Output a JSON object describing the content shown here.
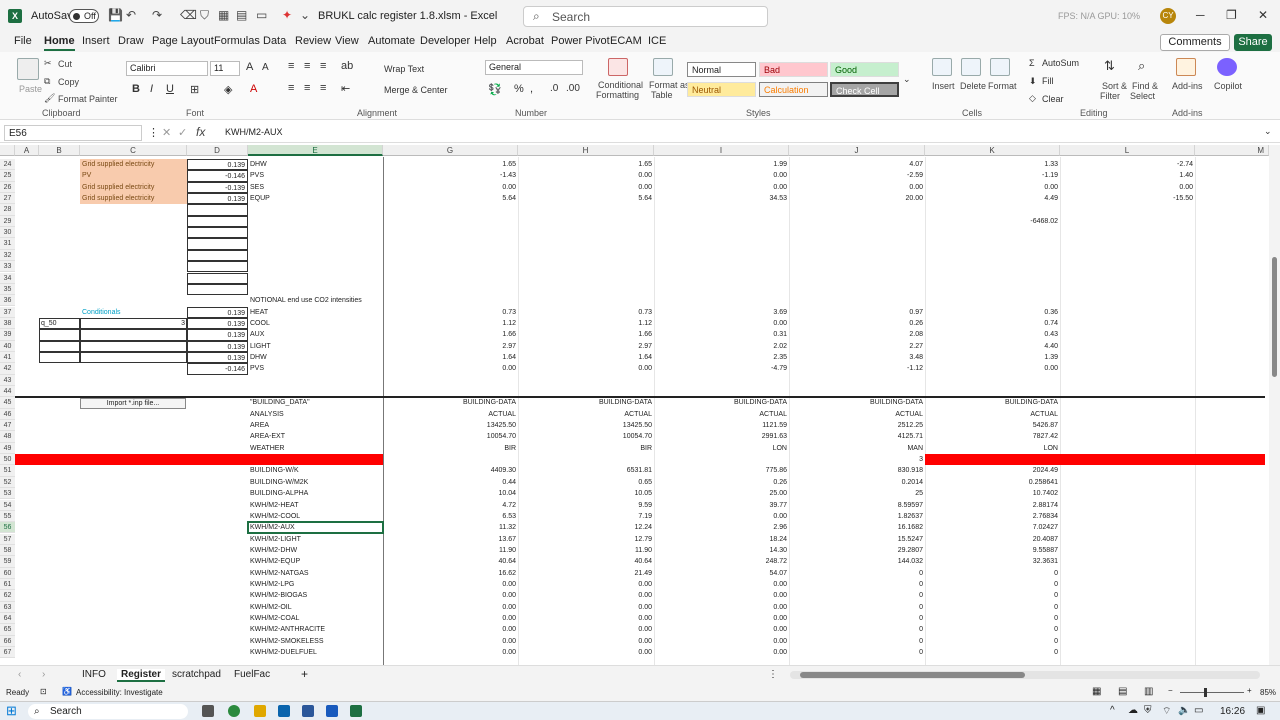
{
  "app": {
    "autosave_label": "AutoSave",
    "toggle_label": "Off",
    "title": "BRUKL calc register 1.8.xlsm  -  Excel",
    "search_placeholder": "Search",
    "status_top": "FPS: N/A    GPU: 10%",
    "avatar": "CY"
  },
  "tabs": [
    "File",
    "Home",
    "Insert",
    "Draw",
    "Page Layout",
    "Formulas",
    "Data",
    "Review",
    "View",
    "Automate",
    "Developer",
    "Help",
    "Acrobat",
    "Power Pivot",
    "ECAM",
    "ICE"
  ],
  "comments": "Comments",
  "share": "Share",
  "ribbon": {
    "clipboard": {
      "paste": "Paste",
      "cut": "Cut",
      "copy": "Copy",
      "painter": "Format Painter",
      "group": "Clipboard"
    },
    "font": {
      "name": "Calibri",
      "size": "11",
      "group": "Font"
    },
    "alignment": {
      "wrap": "Wrap Text",
      "merge": "Merge & Center",
      "group": "Alignment"
    },
    "number": {
      "format": "General",
      "group": "Number"
    },
    "styles": {
      "cond": "Conditional",
      "cond2": "Formatting",
      "table": "Format as",
      "table2": "Table",
      "normal": "Normal",
      "bad": "Bad",
      "good": "Good",
      "neutral": "Neutral",
      "calculation": "Calculation",
      "check": "Check Cell",
      "group": "Styles"
    },
    "cells": {
      "insert": "Insert",
      "delete": "Delete",
      "format": "Format",
      "group": "Cells"
    },
    "editing": {
      "autosum": "AutoSum",
      "fill": "Fill",
      "clear": "Clear",
      "sort": "Sort &",
      "sort2": "Filter",
      "find": "Find &",
      "find2": "Select",
      "group": "Editing"
    },
    "addins": {
      "label": "Add-ins",
      "group": "Add-ins"
    },
    "copilot": {
      "label": "Copilot"
    }
  },
  "formula_bar": {
    "name_box": "E56",
    "formula": "KWH/M2-AUX"
  },
  "columns": [
    "A",
    "B",
    "C",
    "D",
    "E",
    "G",
    "H",
    "I",
    "J",
    "K",
    "L",
    "M"
  ],
  "rows": [
    {
      "n": "24",
      "c": "Grid supplied electricity",
      "d": "0.139",
      "e": "DHW",
      "g": "1.65",
      "h": "1.65",
      "i": "1.99",
      "j": "4.07",
      "k": "1.33",
      "l": "-2.74"
    },
    {
      "n": "25",
      "c": "PV",
      "d": "-0.146",
      "e": "PVS",
      "g": "-1.43",
      "h": "0.00",
      "i": "0.00",
      "j": "-2.59",
      "k": "-1.19",
      "l": "1.40"
    },
    {
      "n": "26",
      "c": "Grid supplied electricity",
      "d": "-0.139",
      "e": "SES",
      "g": "0.00",
      "h": "0.00",
      "i": "0.00",
      "j": "0.00",
      "k": "0.00",
      "l": "0.00"
    },
    {
      "n": "27",
      "c": "Grid supplied electricity",
      "d": "0.139",
      "e": "EQUP",
      "g": "5.64",
      "h": "5.64",
      "i": "34.53",
      "j": "20.00",
      "k": "4.49",
      "l": "-15.50"
    },
    {
      "n": "28"
    },
    {
      "n": "29",
      "k": "-6468.02"
    },
    {
      "n": "30"
    },
    {
      "n": "31"
    },
    {
      "n": "32"
    },
    {
      "n": "33"
    },
    {
      "n": "34"
    },
    {
      "n": "35"
    },
    {
      "n": "36",
      "e": "NOTIONAL end use CO2 intensities"
    },
    {
      "n": "37",
      "c": "Conditionals",
      "d": "0.139",
      "e": "HEAT",
      "g": "0.73",
      "h": "0.73",
      "i": "3.69",
      "j": "0.97",
      "k": "0.36"
    },
    {
      "n": "38",
      "b": "q_50",
      "c": "3",
      "d": "0.139",
      "e": "COOL",
      "g": "1.12",
      "h": "1.12",
      "i": "0.00",
      "j": "0.26",
      "k": "0.74"
    },
    {
      "n": "39",
      "d": "0.139",
      "e": "AUX",
      "g": "1.66",
      "h": "1.66",
      "i": "0.31",
      "j": "2.08",
      "k": "0.43"
    },
    {
      "n": "40",
      "d": "0.139",
      "e": "LIGHT",
      "g": "2.97",
      "h": "2.97",
      "i": "2.02",
      "j": "2.27",
      "k": "4.40"
    },
    {
      "n": "41",
      "d": "0.139",
      "e": "DHW",
      "g": "1.64",
      "h": "1.64",
      "i": "2.35",
      "j": "3.48",
      "k": "1.39"
    },
    {
      "n": "42",
      "d": "-0.146",
      "e": "PVS",
      "g": "0.00",
      "h": "0.00",
      "i": "-4.79",
      "j": "-1.12",
      "k": "0.00"
    },
    {
      "n": "43"
    },
    {
      "n": "44"
    },
    {
      "n": "45",
      "e": "\"BUILDING_DATA\"",
      "g": "BUILDING-DATA",
      "h": "BUILDING-DATA",
      "i": "BUILDING-DATA",
      "j": "BUILDING-DATA",
      "k": "BUILDING-DATA"
    },
    {
      "n": "46",
      "e": "ANALYSIS",
      "g": "ACTUAL",
      "h": "ACTUAL",
      "i": "ACTUAL",
      "j": "ACTUAL",
      "k": "ACTUAL"
    },
    {
      "n": "47",
      "e": "AREA",
      "g": "13425.50",
      "h": "13425.50",
      "i": "1121.59",
      "j": "2512.25",
      "k": "5426.87"
    },
    {
      "n": "48",
      "e": "AREA-EXT",
      "g": "10054.70",
      "h": "10054.70",
      "i": "2991.63",
      "j": "4125.71",
      "k": "7827.42"
    },
    {
      "n": "49",
      "e": "WEATHER",
      "g": "BIR",
      "h": "BIR",
      "i": "LON",
      "j": "MAN",
      "k": "LON"
    },
    {
      "n": "50",
      "g": "3.00",
      "h": "3.00",
      "i": "3.00",
      "j": "3"
    },
    {
      "n": "51",
      "e": "BUILDING-W/K",
      "g": "4409.30",
      "h": "6531.81",
      "i": "775.86",
      "j": "830.918",
      "k": "2024.49"
    },
    {
      "n": "52",
      "e": "BUILDING-W/M2K",
      "g": "0.44",
      "h": "0.65",
      "i": "0.26",
      "j": "0.2014",
      "k": "0.258641"
    },
    {
      "n": "53",
      "e": "BUILDING-ALPHA",
      "g": "10.04",
      "h": "10.05",
      "i": "25.00",
      "j": "25",
      "k": "10.7402"
    },
    {
      "n": "54",
      "e": "KWH/M2-HEAT",
      "g": "4.72",
      "h": "9.59",
      "i": "39.77",
      "j": "8.59597",
      "k": "2.88174"
    },
    {
      "n": "55",
      "e": "KWH/M2-COOL",
      "g": "6.53",
      "h": "7.19",
      "i": "0.00",
      "j": "1.82637",
      "k": "2.76834"
    },
    {
      "n": "56",
      "e": "KWH/M2-AUX",
      "g": "11.32",
      "h": "12.24",
      "i": "2.96",
      "j": "16.1682",
      "k": "7.02427"
    },
    {
      "n": "57",
      "e": "KWH/M2-LIGHT",
      "g": "13.67",
      "h": "12.79",
      "i": "18.24",
      "j": "15.5247",
      "k": "20.4087"
    },
    {
      "n": "58",
      "e": "KWH/M2-DHW",
      "g": "11.90",
      "h": "11.90",
      "i": "14.30",
      "j": "29.2807",
      "k": "9.55887"
    },
    {
      "n": "59",
      "e": "KWH/M2-EQUP",
      "g": "40.64",
      "h": "40.64",
      "i": "248.72",
      "j": "144.032",
      "k": "32.3631"
    },
    {
      "n": "60",
      "e": "KWH/M2-NATGAS",
      "g": "16.62",
      "h": "21.49",
      "i": "54.07",
      "j": "0",
      "k": "0"
    },
    {
      "n": "61",
      "e": "KWH/M2-LPG",
      "g": "0.00",
      "h": "0.00",
      "i": "0.00",
      "j": "0",
      "k": "0"
    },
    {
      "n": "62",
      "e": "KWH/M2-BIOGAS",
      "g": "0.00",
      "h": "0.00",
      "i": "0.00",
      "j": "0",
      "k": "0"
    },
    {
      "n": "63",
      "e": "KWH/M2-OIL",
      "g": "0.00",
      "h": "0.00",
      "i": "0.00",
      "j": "0",
      "k": "0"
    },
    {
      "n": "64",
      "e": "KWH/M2-COAL",
      "g": "0.00",
      "h": "0.00",
      "i": "0.00",
      "j": "0",
      "k": "0"
    },
    {
      "n": "65",
      "e": "KWH/M2-ANTHRACITE",
      "g": "0.00",
      "h": "0.00",
      "i": "0.00",
      "j": "0",
      "k": "0"
    },
    {
      "n": "66",
      "e": "KWH/M2-SMOKELESS",
      "g": "0.00",
      "h": "0.00",
      "i": "0.00",
      "j": "0",
      "k": "0"
    },
    {
      "n": "67",
      "e": "KWH/M2-DUELFUEL",
      "g": "0.00",
      "h": "0.00",
      "i": "0.00",
      "j": "0",
      "k": "0"
    }
  ],
  "import_button": "Import *.inp file...",
  "sheets": [
    "INFO",
    "Register",
    "scratchpad",
    "FuelFac"
  ],
  "status": {
    "ready": "Ready",
    "access": "Accessibility: Investigate",
    "zoom": "85%"
  },
  "taskbar": {
    "search": "Search",
    "time": "16:26"
  }
}
